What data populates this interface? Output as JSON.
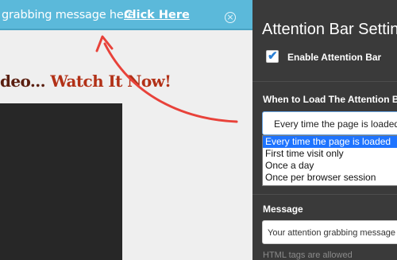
{
  "attention_bar": {
    "message": "grabbing message here",
    "link_label": "Click Here",
    "close_symbol": "×"
  },
  "headline": {
    "prefix": "deo...",
    "cta": "Watch It Now!"
  },
  "settings": {
    "title": "Attention Bar Settings",
    "enable_label": "Enable Attention Bar",
    "enable_checked": true,
    "when_to_load_label": "When to Load The Attention Bar",
    "load_select_value": "Every time the page is loaded",
    "load_options": [
      "Every time the page is loaded",
      "First time visit only",
      "Once a day",
      "Once per browser session"
    ],
    "message_label": "Message",
    "message_value": "Your attention grabbing message here",
    "hint": "HTML tags are allowed"
  },
  "colors": {
    "bar_blue": "#5bb9da",
    "panel_dark": "#3a3a3a",
    "arrow_red": "#e8423a",
    "selected_option": "#1e74ff"
  }
}
